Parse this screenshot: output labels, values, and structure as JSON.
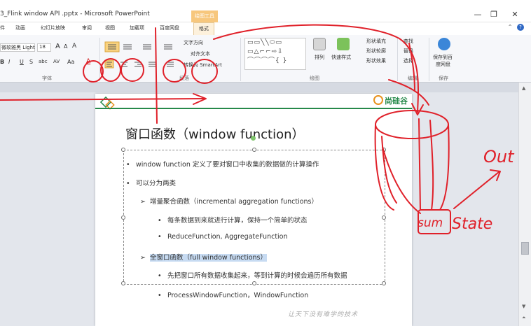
{
  "window": {
    "title": "3_Flink window API .pptx - Microsoft PowerPoint",
    "context_tab": "绘图工具",
    "btn_min": "—",
    "btn_max": "❐",
    "btn_close": "✕"
  },
  "menu": {
    "tabs": [
      "件",
      "动画",
      "幻灯片放映",
      "审阅",
      "视图",
      "加载项",
      "百度网盘",
      "格式"
    ],
    "active_index": 7,
    "right_icons": "⌃",
    "help": "?"
  },
  "ribbon": {
    "font_name": "微软雅黑 Light",
    "font_size": "18",
    "grow_font": "A",
    "shrink_font": "A",
    "clear_format": "A",
    "bold": "B",
    "italic": "I",
    "underline": "U",
    "strike": "S",
    "shadow": "abc",
    "spacing": "AV",
    "change_case": "Aa",
    "font_color": "A",
    "text_direction": "文字方向",
    "align_text": "对齐文本",
    "smartart": "转换为 SmartArt",
    "arrange": "排列",
    "quick_styles": "快速样式",
    "shape_fill": "形状填充",
    "shape_outline": "形状轮廓",
    "shape_effects": "形状效果",
    "find": "查找",
    "replace": "替换",
    "select": "选择",
    "save_baidu_1": "保存到百",
    "save_baidu_2": "度网盘",
    "group_font": "字体",
    "group_paragraph": "段落",
    "group_drawing": "绘图",
    "group_editing": "编辑",
    "group_save": "保存",
    "shapes_row1": "▭▭╲╲⬭▭",
    "shapes_row2": "▭△⌐⌐⇨⇩",
    "shapes_row3": "⌒⌒⌒⌒{ }"
  },
  "slide": {
    "brand": "尚硅谷",
    "title": "窗口函数（window function）",
    "bullets": [
      {
        "marker": "•",
        "text": "window function 定义了要对窗口中收集的数据做的计算操作"
      },
      {
        "marker": "•",
        "text": "可以分为两类"
      },
      {
        "marker": "➢",
        "text": "增量聚合函数（incremental aggregation functions）"
      },
      {
        "marker": "•",
        "text": "每条数据到来就进行计算，保持一个简单的状态"
      },
      {
        "marker": "•",
        "text": "ReduceFunction, AggregateFunction"
      },
      {
        "marker": "➢",
        "text": "全窗口函数（full window functions）"
      },
      {
        "marker": "•",
        "text": "先把窗口所有数据收集起来，等到计算的时候会遍历所有数据"
      },
      {
        "marker": "•",
        "text": "ProcessWindowFunction，WindowFunction"
      }
    ],
    "footer": "让天下没有难学的技术"
  },
  "annotations": {
    "out_label": "Out",
    "sum_label": "sum",
    "state_label": "State",
    "stroke_color": "#e0212a"
  }
}
